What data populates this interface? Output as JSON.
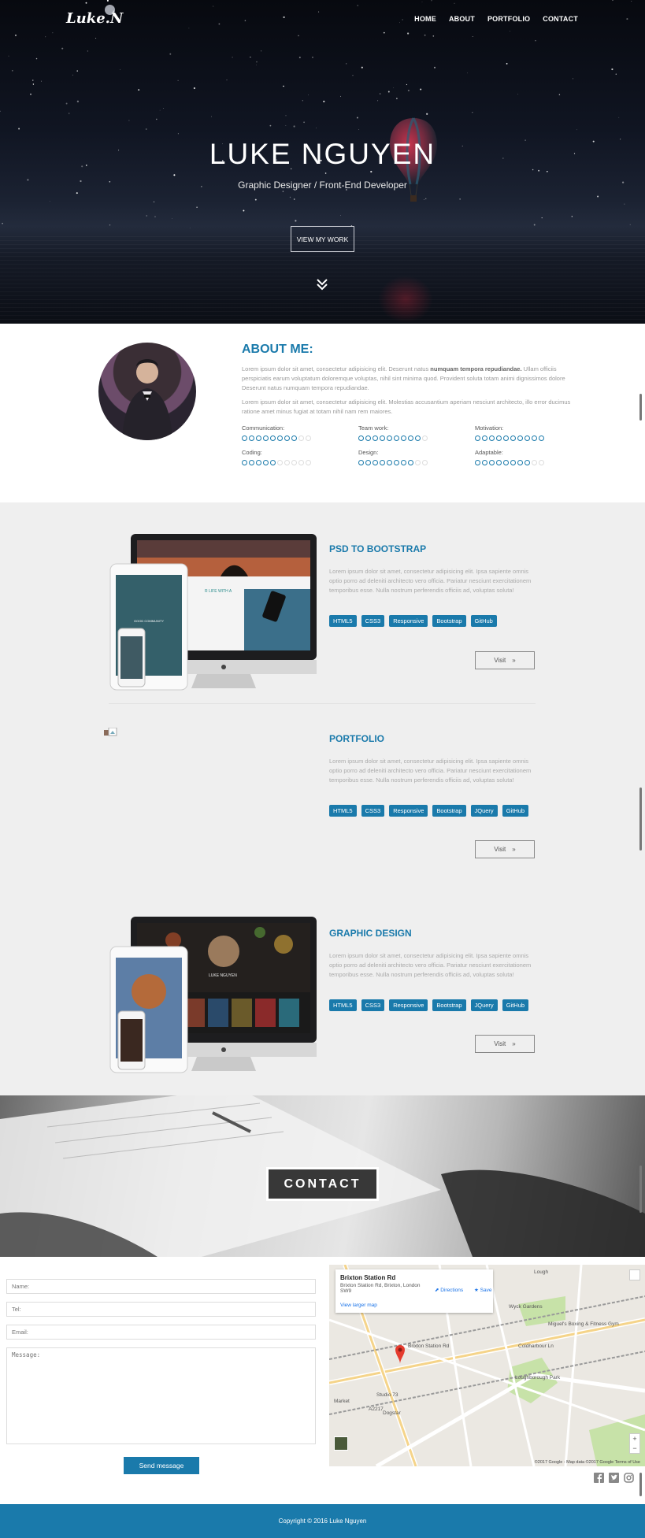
{
  "nav": {
    "logo": "Luke.N",
    "items": [
      "HOME",
      "ABOUT",
      "PORTFOLIO",
      "CONTACT"
    ]
  },
  "hero": {
    "name": "LUKE NGUYEN",
    "subtitle": "Graphic Designer / Front-End Developer",
    "button": "VIEW MY WORK"
  },
  "about": {
    "title": "ABOUT ME:",
    "p1_a": "Lorem ipsum dolor sit amet, consectetur adipisicing elit. Deserunt natus ",
    "p1_b": "numquam tempora repudiandae.",
    "p1_c": " Ullam officiis perspiciatis earum voluptatum doloremque voluptas, nihil sint minima quod. Provident soluta totam animi dignissimos dolore Deserunt natus numquam tempora repudiandae.",
    "p2": "Lorem ipsum dolor sit amet, consectetur adipisicing elit. Molestias accusantium aperiam nesciunt architecto, illo error ducimus ratione amet minus fugiat at totam nihil nam rem maiores.",
    "skills": [
      {
        "label": "Communication:",
        "level": 8,
        "max": 10
      },
      {
        "label": "Team work:",
        "level": 9,
        "max": 10
      },
      {
        "label": "Motivation:",
        "level": 10,
        "max": 10
      },
      {
        "label": "Coding:",
        "level": 5,
        "max": 10
      },
      {
        "label": "Design:",
        "level": 8,
        "max": 10
      },
      {
        "label": "Adaptable:",
        "level": 8,
        "max": 10
      }
    ]
  },
  "projects": [
    {
      "title": "PSD TO BOOTSTRAP",
      "desc": "Lorem ipsum dolor sit amet, consectetur adipisicing elit. Ipsa sapiente omnis optio porro ad deleniti architecto vero officia. Pariatur nesciunt exercitationem temporibus esse. Nulla nostrum perferendis officiis ad, voluptas soluta!",
      "tags": [
        "HTML5",
        "CSS3",
        "Responsive",
        "Bootstrap",
        "GitHub"
      ],
      "visit": "Visit",
      "laptop_text": "R LIFE WITH A",
      "tablet_text": "GOOD COMMUNITY"
    },
    {
      "title": "PORTFOLIO",
      "desc": "Lorem ipsum dolor sit amet, consectetur adipisicing elit. Ipsa sapiente omnis optio porro ad deleniti architecto vero officia. Pariatur nesciunt exercitationem temporibus esse. Nulla nostrum perferendis officiis ad, voluptas soluta!",
      "tags": [
        "HTML5",
        "CSS3",
        "Responsive",
        "Bootstrap",
        "JQuery",
        "GitHub"
      ],
      "visit": "Visit"
    },
    {
      "title": "GRAPHIC DESIGN",
      "desc": "Lorem ipsum dolor sit amet, consectetur adipisicing elit. Ipsa sapiente omnis optio porro ad deleniti architecto vero officia. Pariatur nesciunt exercitationem temporibus esse. Nulla nostrum perferendis officiis ad, voluptas soluta!",
      "tags": [
        "HTML5",
        "CSS3",
        "Responsive",
        "Bootstrap",
        "JQuery",
        "GitHub"
      ],
      "visit": "Visit",
      "laptop_text": "LUKE NGUYEN"
    }
  ],
  "contact": {
    "banner": "CONTACT",
    "name_placeholder": "Name:",
    "tel_placeholder": "Tel:",
    "email_placeholder": "Email:",
    "message_placeholder": "Message:",
    "send": "Send message"
  },
  "map": {
    "place": "Brixton Station Rd",
    "address": "Brixton Station Rd, Brixton, London SW9",
    "larger": "View larger map",
    "directions": "Directions",
    "save": "Save",
    "labels": [
      "Miguel's Boxing & Fitness Gym",
      "Wyck Gardens",
      "Loughborough Park",
      "Brixton Station Rd",
      "Studio 73",
      "Dogstar",
      "Market",
      "A2217",
      "Coldharbour Ln",
      "Lough"
    ],
    "copyright": "©2017 Google - Map data ©2017 Google    Terms of Use"
  },
  "social": {
    "icons": [
      "facebook-icon",
      "twitter-icon",
      "instagram-icon"
    ]
  },
  "footer": {
    "copyright": "Copyright © 2016 Luke Nguyen"
  },
  "colors": {
    "accent": "#1a7aab",
    "footer": "#1a7aab",
    "section_bg": "#efefef"
  }
}
